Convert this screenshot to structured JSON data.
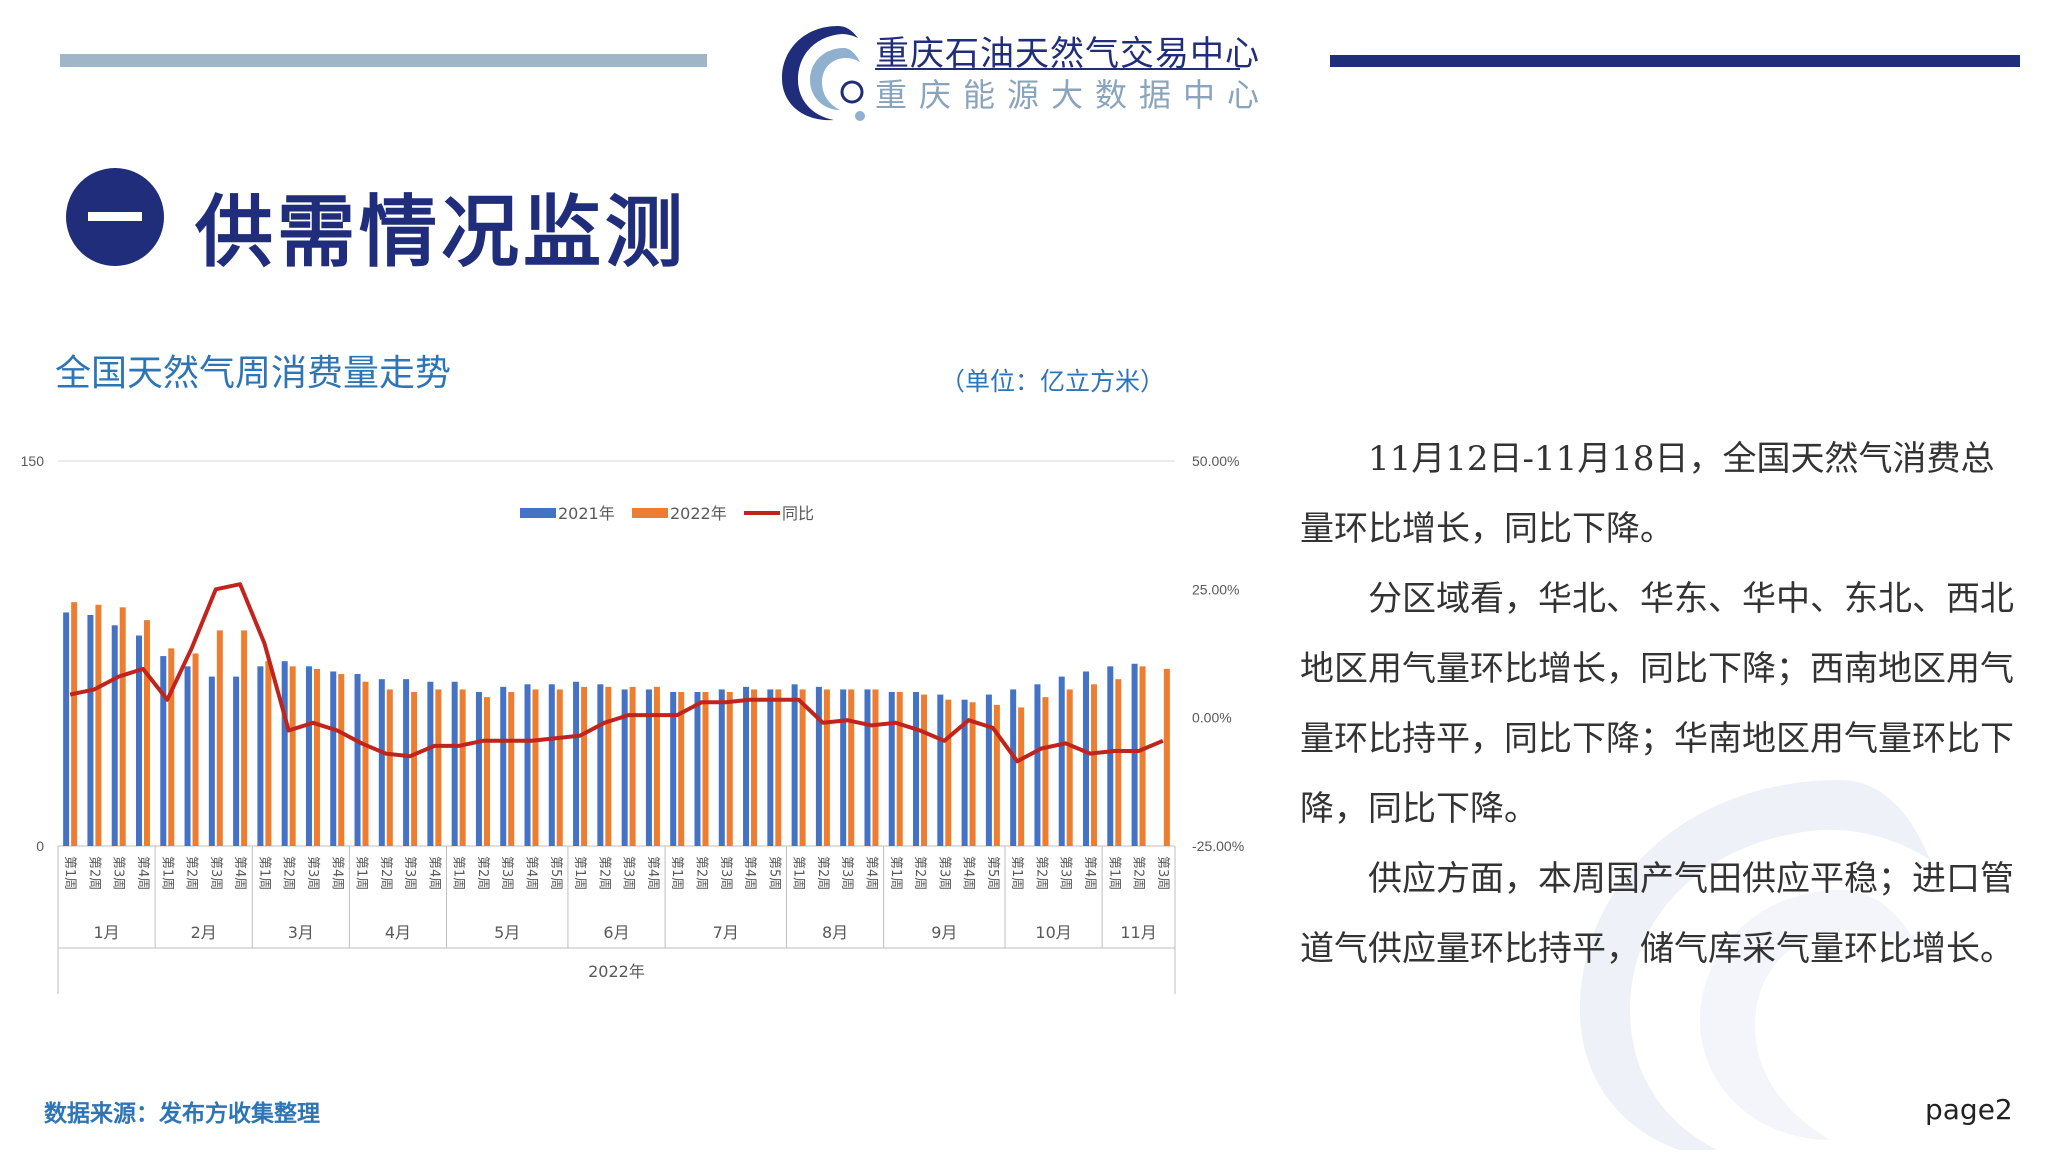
{
  "header": {
    "org_name": "重庆石油天然气交易中心",
    "org_sub": "重庆能源大数据中心",
    "colors": {
      "navy": "#1f2d7a",
      "light_blue_bar": "#9fb6c9"
    }
  },
  "section": {
    "number": "一",
    "title": "供需情况监测"
  },
  "chart_title": "全国天然气周消费量走势",
  "chart_unit": "（单位：亿立方米）",
  "paragraphs": [
    "11月12日-11月18日，全国天然气消费总量环比增长，同比下降。",
    "分区域看，华北、华东、华中、东北、西北地区用气量环比增长，同比下降；西南地区用气量环比持平，同比下降；华南地区用气量环比下降，同比下降。",
    "供应方面，本周国产气田供应平稳；进口管道气供应量环比持平，储气库采气量环比增长。"
  ],
  "footer": {
    "source": "数据来源：发布方收集整理",
    "page": "page2"
  },
  "chart_data": {
    "type": "bar",
    "title": "",
    "year_label": "2022年",
    "left_axis": {
      "min": 0,
      "max": 150,
      "ticks": [
        0,
        150
      ]
    },
    "right_axis": {
      "min": -25,
      "max": 50,
      "ticks": [
        "50.00%",
        "25.00%",
        "0.00%",
        "-25.00%"
      ]
    },
    "legend_position": "top",
    "categories": [
      "第1周",
      "第2周",
      "第3周",
      "第4周",
      "第1周",
      "第2周",
      "第3周",
      "第4周",
      "第1周",
      "第2周",
      "第3周",
      "第4周",
      "第1周",
      "第2周",
      "第3周",
      "第4周",
      "第1周",
      "第2周",
      "第3周",
      "第4周",
      "第5周",
      "第1周",
      "第2周",
      "第3周",
      "第4周",
      "第1周",
      "第2周",
      "第3周",
      "第4周",
      "第5周",
      "第1周",
      "第2周",
      "第3周",
      "第4周",
      "第1周",
      "第2周",
      "第3周",
      "第4周",
      "第5周",
      "第1周",
      "第2周",
      "第3周",
      "第4周",
      "第1周",
      "第2周",
      "第3周"
    ],
    "months": [
      {
        "label": "1月",
        "count": 4
      },
      {
        "label": "2月",
        "count": 4
      },
      {
        "label": "3月",
        "count": 4
      },
      {
        "label": "4月",
        "count": 4
      },
      {
        "label": "5月",
        "count": 5
      },
      {
        "label": "6月",
        "count": 4
      },
      {
        "label": "7月",
        "count": 5
      },
      {
        "label": "8月",
        "count": 4
      },
      {
        "label": "9月",
        "count": 5
      },
      {
        "label": "10月",
        "count": 4
      },
      {
        "label": "11月",
        "count": 3
      }
    ],
    "series": [
      {
        "name": "2021年",
        "type": "bar",
        "axis": "left",
        "color": "#4472c4",
        "values": [
          91,
          90,
          86,
          82,
          74,
          70,
          66,
          66,
          70,
          72,
          70,
          68,
          67,
          65,
          65,
          64,
          64,
          60,
          62,
          63,
          63,
          64,
          63,
          61,
          61,
          60,
          60,
          61,
          62,
          61,
          63,
          62,
          61,
          61,
          60,
          60,
          59,
          57,
          59,
          61,
          63,
          66,
          68,
          70,
          71
        ]
      },
      {
        "name": "2022年",
        "type": "bar",
        "axis": "left",
        "color": "#ed7d31",
        "values": [
          95,
          94,
          93,
          88,
          77,
          75,
          84,
          84,
          72,
          70,
          69,
          67,
          64,
          61,
          60,
          61,
          61,
          58,
          60,
          61,
          61,
          62,
          62,
          62,
          62,
          60,
          60,
          60,
          61,
          61,
          61,
          61,
          61,
          61,
          60,
          59,
          57,
          56,
          55,
          54,
          58,
          61,
          63,
          65,
          70,
          69
        ]
      },
      {
        "name": "同比",
        "type": "line",
        "axis": "right",
        "color": "#c0241c",
        "values": [
          4.5,
          5.5,
          8.0,
          9.5,
          3.5,
          13.5,
          25.0,
          26.0,
          14.5,
          -2.5,
          -1.0,
          -2.5,
          -5.0,
          -7.0,
          -7.5,
          -5.5,
          -5.5,
          -4.5,
          -4.5,
          -4.5,
          -4.0,
          -3.5,
          -1.0,
          0.5,
          0.5,
          0.5,
          3.0,
          3.0,
          3.5,
          3.5,
          3.5,
          -1.0,
          -0.5,
          -1.5,
          -1.0,
          -2.5,
          -4.5,
          -0.5,
          -2.0,
          -8.5,
          -6.0,
          -5.0,
          -7.0,
          -6.5,
          -6.5,
          -4.5
        ]
      }
    ]
  }
}
